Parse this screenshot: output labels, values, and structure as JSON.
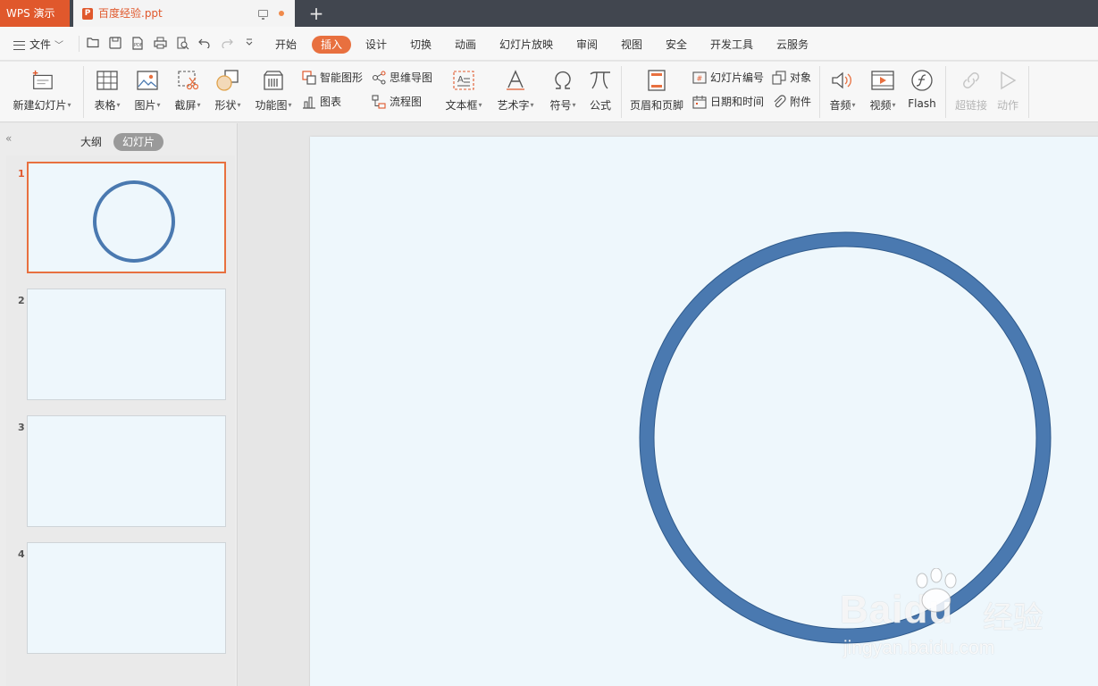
{
  "titlebar": {
    "app_label": "WPS 演示",
    "doc_tab": "百度经验.ppt",
    "new_tab": "+"
  },
  "menu": {
    "file_label": "文件",
    "tabs": [
      "开始",
      "插入",
      "设计",
      "切换",
      "动画",
      "幻灯片放映",
      "审阅",
      "视图",
      "安全",
      "开发工具",
      "云服务"
    ],
    "active_tab": "插入"
  },
  "ribbon": {
    "new_slide": "新建幻灯片",
    "table": "表格",
    "picture": "图片",
    "screenshot": "截屏",
    "shape": "形状",
    "function_chart": "功能图",
    "smart_art": "智能图形",
    "chart": "图表",
    "mind_map": "思维导图",
    "flowchart": "流程图",
    "textbox": "文本框",
    "word_art": "艺术字",
    "symbol": "符号",
    "formula": "公式",
    "header_footer": "页眉和页脚",
    "slide_number": "幻灯片编号",
    "object": "对象",
    "date_time": "日期和时间",
    "attachment": "附件",
    "audio": "音频",
    "video": "视频",
    "flash": "Flash",
    "hyperlink": "超链接",
    "action": "动作"
  },
  "left_panel": {
    "outline_tab": "大纲",
    "slides_tab": "幻灯片",
    "collapse": "«",
    "slide_numbers": [
      "1",
      "2",
      "3",
      "4"
    ],
    "current_slide": "1"
  },
  "watermark": {
    "brand": "Baidu",
    "suffix": "经验",
    "url": "jingyan.baidu.com"
  },
  "colors": {
    "accent": "#e8703f",
    "titlebar": "#41464f",
    "slide_bg": "#eef7fc",
    "circle_fill": "#4a79b0",
    "circle_stroke": "#2f5a8c"
  }
}
